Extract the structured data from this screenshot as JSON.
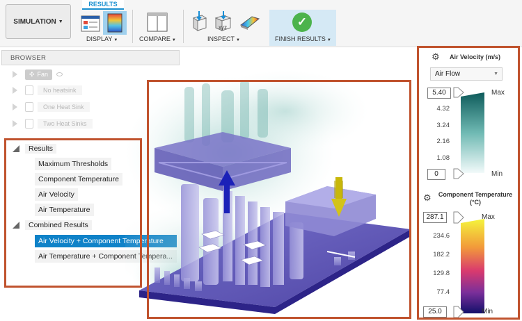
{
  "toolbar": {
    "simulation_label": "SIMULATION",
    "results_tab_label": "RESULTS",
    "display_label": "DISPLAY",
    "compare_label": "COMPARE",
    "inspect_label": "INSPECT",
    "finish_label": "FINISH RESULTS",
    "inspect_xyz": "xyz"
  },
  "browser": {
    "header": "BROWSER",
    "studies": [
      {
        "label": "Fan",
        "icon": "fan-icon"
      },
      {
        "label": "No heatsink",
        "icon": "document-icon"
      },
      {
        "label": "One Heat Sink",
        "icon": "document-icon"
      },
      {
        "label": "Two Heat Sinks",
        "icon": "document-icon"
      }
    ],
    "results_folder": "Results",
    "results": [
      "Maximum Thresholds",
      "Component Temperature",
      "Air Velocity",
      "Air Temperature"
    ],
    "combined_folder": "Combined Results",
    "combined": [
      "Air Velocity + Component Temperature",
      "Air Temperature + Component Tempera..."
    ]
  },
  "air_velocity_legend": {
    "title": "Air Velocity (m/s)",
    "dropdown_value": "Air Flow",
    "max_value": "5.40",
    "min_value": "0",
    "ticks": [
      "4.32",
      "3.24",
      "2.16",
      "1.08"
    ],
    "max_label": "Max",
    "min_label": "Min",
    "gradient_top": "#0e5b5b",
    "gradient_bottom": "#f2fafa"
  },
  "component_temp_legend": {
    "title": "Component Temperature (°C)",
    "max_value": "287.1",
    "min_value": "25.0",
    "ticks": [
      "234.6",
      "182.2",
      "129.8",
      "77.4"
    ],
    "max_label": "Max",
    "min_label": "Min",
    "gradient_top": "#f4f43c",
    "gradient_bottom": "#12106a"
  },
  "colors": {
    "highlight_frame": "#c0532e",
    "selection": "#0f82c8",
    "finish_bg": "#d5e9f5",
    "check_green": "#4cb34c"
  }
}
